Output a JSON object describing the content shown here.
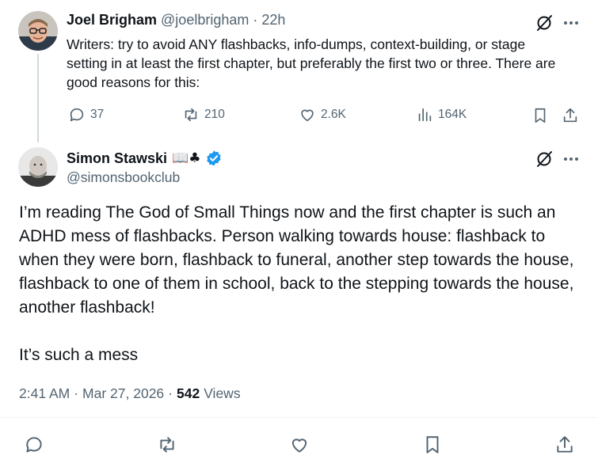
{
  "parent_post": {
    "author_name": "Joel Brigham",
    "author_handle": "@joelbrigham",
    "separator": "·",
    "time_ago": "22h",
    "text": "Writers: try to avoid ANY flashbacks, info-dumps, context-building, or stage setting in at least the first chapter, but preferably the first two or three. There are good reasons for this:",
    "stats": {
      "replies": "37",
      "reposts": "210",
      "likes": "2.6K",
      "views": "164K"
    }
  },
  "main_post": {
    "author_name": "Simon Stawski",
    "name_emojis": "📖♣",
    "author_handle": "@simonsbookclub",
    "paragraph_1": "I’m reading The God of Small Things now and the first chapter is such an ADHD mess of flashbacks. Person walking towards house: flashback to when they were born, flashback to funeral, another step towards the house, flashback to one of them in school, back to the stepping towards the house, another flashback!",
    "paragraph_2": "It’s such a mess",
    "time": "2:41 AM",
    "separator": "·",
    "date": "Mar 27, 2026",
    "views_count": "542",
    "views_label": "Views"
  },
  "colors": {
    "text": "#0f1419",
    "secondary": "#536471",
    "verified": "#1d9bf0",
    "divider": "#eff3f4"
  },
  "icons": [
    "grok-icon",
    "more-icon",
    "reply-icon",
    "repost-icon",
    "like-icon",
    "views-icon",
    "bookmark-icon",
    "share-icon",
    "verified-badge-icon"
  ]
}
